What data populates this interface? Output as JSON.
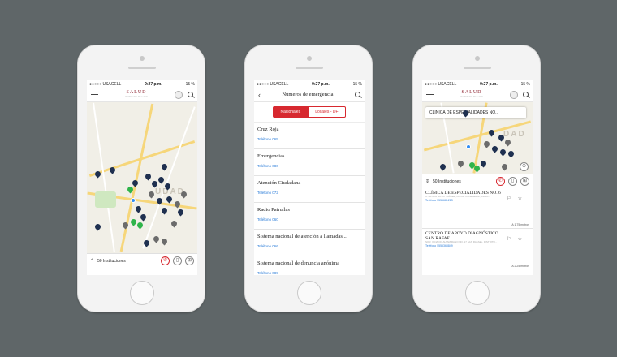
{
  "status": {
    "carrier": "●●○○○ USACELL",
    "time": "9:27 p.m.",
    "battery": "15 %"
  },
  "logo": {
    "text": "SALUD",
    "subtitle": "SECRETARÍA DE SALUD"
  },
  "map_screen": {
    "institutions_count": "50 Instituciones",
    "map_word": "UDAD"
  },
  "emergency_screen": {
    "title": "Números de emergencia",
    "tab_national": "Nacionales",
    "tab_local": "Locales - DF",
    "entries": [
      {
        "name": "Cruz Roja",
        "tel": "Teléfono 065"
      },
      {
        "name": "Emergencias",
        "tel": "Teléfono 080"
      },
      {
        "name": "Atención Ciudadana",
        "tel": "Teléfono 072"
      },
      {
        "name": "Radio Patrullas",
        "tel": "Teléfono 060"
      },
      {
        "name": "Sistema nacional de atención a llamadas...",
        "tel": "Teléfono 066"
      },
      {
        "name": "Sistema nacional de denuncia anónima",
        "tel": "Teléfono 089"
      }
    ]
  },
  "list_screen": {
    "callout": "CLÍNICA DE ESPECIALIDADES NO...",
    "institutions_count": "50 Instituciones",
    "map_word": "DAD",
    "items": [
      {
        "name": "CLÍNICA DE ESPECIALIDADES NO. 6",
        "address": "C. ALTATA NO. 47 JUÁREZ, DISTRITO FEDERAL, CDMX...",
        "tel": "Teléfono 5556681213",
        "distance": "A 1.75 metros"
      },
      {
        "name": "CENTRO DE APOYO DIAGNÓSTICO SAN RAFAE...",
        "address": "SOR. IGNACIO ALTAMIRANO NO. 17 SAN RAFAEL, DISTRITO...",
        "tel": "Teléfono 5555368849",
        "distance": "A 2.25 metros"
      }
    ]
  },
  "colors": {
    "brand_red": "#d7282f",
    "pin_navy": "#1f3050",
    "pin_green": "#2fb44a",
    "link_blue": "#2f7fd9"
  }
}
